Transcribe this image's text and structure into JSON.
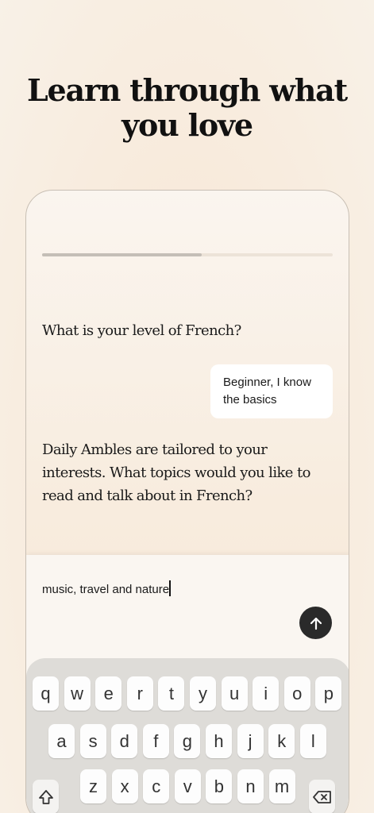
{
  "headline": {
    "line1": "Learn through what",
    "line2": "you love"
  },
  "progress": {
    "value": 0.55
  },
  "chat": {
    "question1": "What is your level of French?",
    "answer1": "Beginner, I know the basics",
    "question2": "Daily Ambles are tailored to your interests. What topics would you like to read and talk about in French?"
  },
  "composer": {
    "input_value": "music, travel and nature"
  },
  "keyboard": {
    "row1": [
      "q",
      "w",
      "e",
      "r",
      "t",
      "y",
      "u",
      "i",
      "o",
      "p"
    ],
    "row2": [
      "a",
      "s",
      "d",
      "f",
      "g",
      "h",
      "j",
      "k",
      "l"
    ],
    "row3": [
      "z",
      "x",
      "c",
      "v",
      "b",
      "n",
      "m"
    ]
  },
  "colors": {
    "send_button": "#2a2a2a",
    "keyboard_action": "#1a73e8"
  }
}
